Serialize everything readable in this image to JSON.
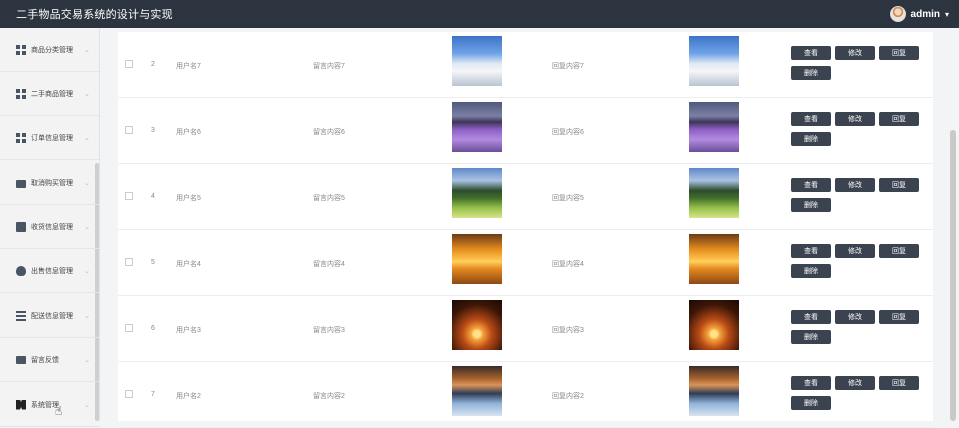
{
  "app": {
    "title": "二手物品交易系统的设计与实现"
  },
  "user": {
    "name": "admin",
    "caret": "▾"
  },
  "sidebar": {
    "items": [
      {
        "label": "商品分类管理",
        "icon": "grid-icon"
      },
      {
        "label": "二手商品管理",
        "icon": "grid-icon"
      },
      {
        "label": "订单信息管理",
        "icon": "grid-icon"
      },
      {
        "label": "取消购买管理",
        "icon": "briefcase-icon"
      },
      {
        "label": "收货信息管理",
        "icon": "clipboard-icon"
      },
      {
        "label": "出售信息管理",
        "icon": "bulb-icon"
      },
      {
        "label": "配送信息管理",
        "icon": "list-icon"
      },
      {
        "label": "留言反馈",
        "icon": "monitor-icon"
      },
      {
        "label": "系统管理",
        "icon": "ticket-icon"
      }
    ],
    "chevron": "⌄"
  },
  "table": {
    "rows": [
      {
        "index": "2",
        "user": "用户名7",
        "message": "留言内容7",
        "reply": "回复内容7",
        "image": "mountain"
      },
      {
        "index": "3",
        "user": "用户名6",
        "message": "留言内容6",
        "reply": "回复内容6",
        "image": "lavender"
      },
      {
        "index": "4",
        "user": "用户名5",
        "message": "留言内容5",
        "reply": "回复内容5",
        "image": "valley"
      },
      {
        "index": "5",
        "user": "用户名4",
        "message": "留言内容4",
        "reply": "回复内容4",
        "image": "sunset"
      },
      {
        "index": "6",
        "user": "用户名3",
        "message": "留言内容3",
        "reply": "回复内容3",
        "image": "palm"
      },
      {
        "index": "7",
        "user": "用户名2",
        "message": "留言内容2",
        "reply": "回复内容2",
        "image": "lake"
      }
    ],
    "actions": {
      "view": "查看",
      "edit": "修改",
      "reply": "回复",
      "delete": "删除"
    }
  },
  "colors": {
    "topbar": "#2c3440",
    "button": "#3b4350"
  }
}
